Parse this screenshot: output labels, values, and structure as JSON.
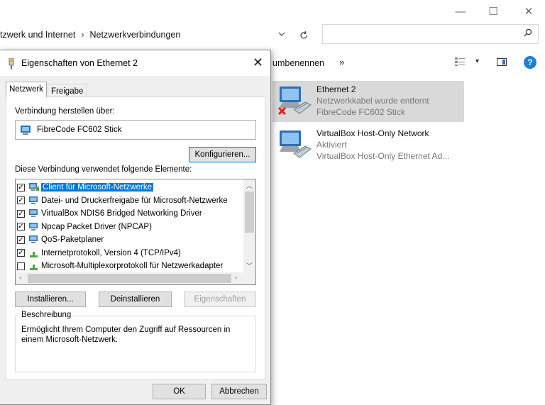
{
  "explorer": {
    "window_controls": {
      "minimize": "—",
      "maximize": "☐",
      "close": "✕"
    },
    "breadcrumb": {
      "part1": "tzwerk und Internet",
      "separator": "›",
      "part2": "Netzwerkverbindungen"
    },
    "search": {
      "placeholder": ""
    },
    "commandbar": {
      "rename": "umbenennen",
      "more": "»"
    },
    "connections": [
      {
        "name": "Ethernet 2",
        "status": "Netzwerkkabel wurde entfernt",
        "device": "FibreCode FC602 Stick",
        "selected": true,
        "disconnected": true
      },
      {
        "name": "VirtualBox Host-Only Network",
        "status": "Aktiviert",
        "device": "VirtualBox Host-Only Ethernet Ad...",
        "selected": false,
        "disconnected": false
      }
    ]
  },
  "dialog": {
    "title": "Eigenschaften von Ethernet 2",
    "tabs": [
      {
        "label": "Netzwerk",
        "active": true
      },
      {
        "label": "Freigabe",
        "active": false
      }
    ],
    "connect_using_label": "Verbindung herstellen über:",
    "adapter_name": "FibreCode FC602 Stick",
    "configure_button": "Konfigurieren...",
    "elements_label": "Diese Verbindung verwendet folgende Elemente:",
    "elements": [
      {
        "label": "Client für Microsoft-Netzwerke",
        "checked": true,
        "selected": true,
        "icon": "network-client-icon"
      },
      {
        "label": "Datei- und Druckerfreigabe für Microsoft-Netzwerke",
        "checked": true,
        "selected": false,
        "icon": "network-service-icon"
      },
      {
        "label": "VirtualBox NDIS6 Bridged Networking Driver",
        "checked": true,
        "selected": false,
        "icon": "network-service-icon"
      },
      {
        "label": "Npcap Packet Driver (NPCAP)",
        "checked": true,
        "selected": false,
        "icon": "network-service-icon"
      },
      {
        "label": "QoS-Paketplaner",
        "checked": true,
        "selected": false,
        "icon": "network-service-icon"
      },
      {
        "label": "Internetprotokoll, Version 4 (TCP/IPv4)",
        "checked": true,
        "selected": false,
        "icon": "protocol-icon"
      },
      {
        "label": "Microsoft-Multiplexorprotokoll für Netzwerkadapter",
        "checked": false,
        "selected": false,
        "icon": "protocol-icon"
      }
    ],
    "install_button": "Installieren...",
    "uninstall_button": "Deinstallieren",
    "properties_button": "Eigenschaften",
    "description_legend": "Beschreibung",
    "description_text": "Ermöglicht Ihrem Computer den Zugriff auf Ressourcen in einem Microsoft-Netzwerk.",
    "ok_button": "OK",
    "cancel_button": "Abbrechen",
    "close_glyph": "✕"
  },
  "colors": {
    "accent": "#0078d7",
    "selection_bg": "#d9d9d9",
    "dialog_bg": "#f0f0f0"
  }
}
